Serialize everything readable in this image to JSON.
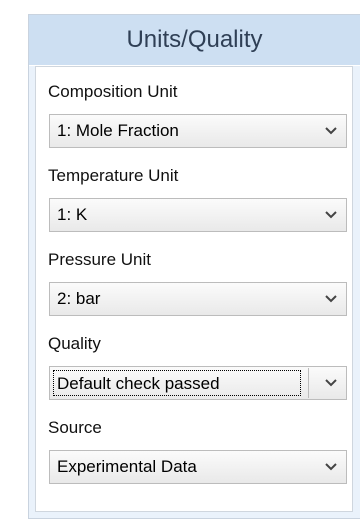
{
  "panel": {
    "title": "Units/Quality"
  },
  "fields": [
    {
      "label": "Composition Unit",
      "value": "1: Mole Fraction"
    },
    {
      "label": "Temperature Unit",
      "value": "1: K"
    },
    {
      "label": "Pressure Unit",
      "value": "2: bar"
    },
    {
      "label": "Quality",
      "value": "Default check passed"
    },
    {
      "label": "Source",
      "value": "Experimental Data"
    }
  ],
  "icons": {
    "dropdown": "chevron-down-icon"
  },
  "colors": {
    "header_bg": "#cddff2",
    "panel_bg": "#eaf2fb",
    "title_text": "#2f3f55"
  }
}
